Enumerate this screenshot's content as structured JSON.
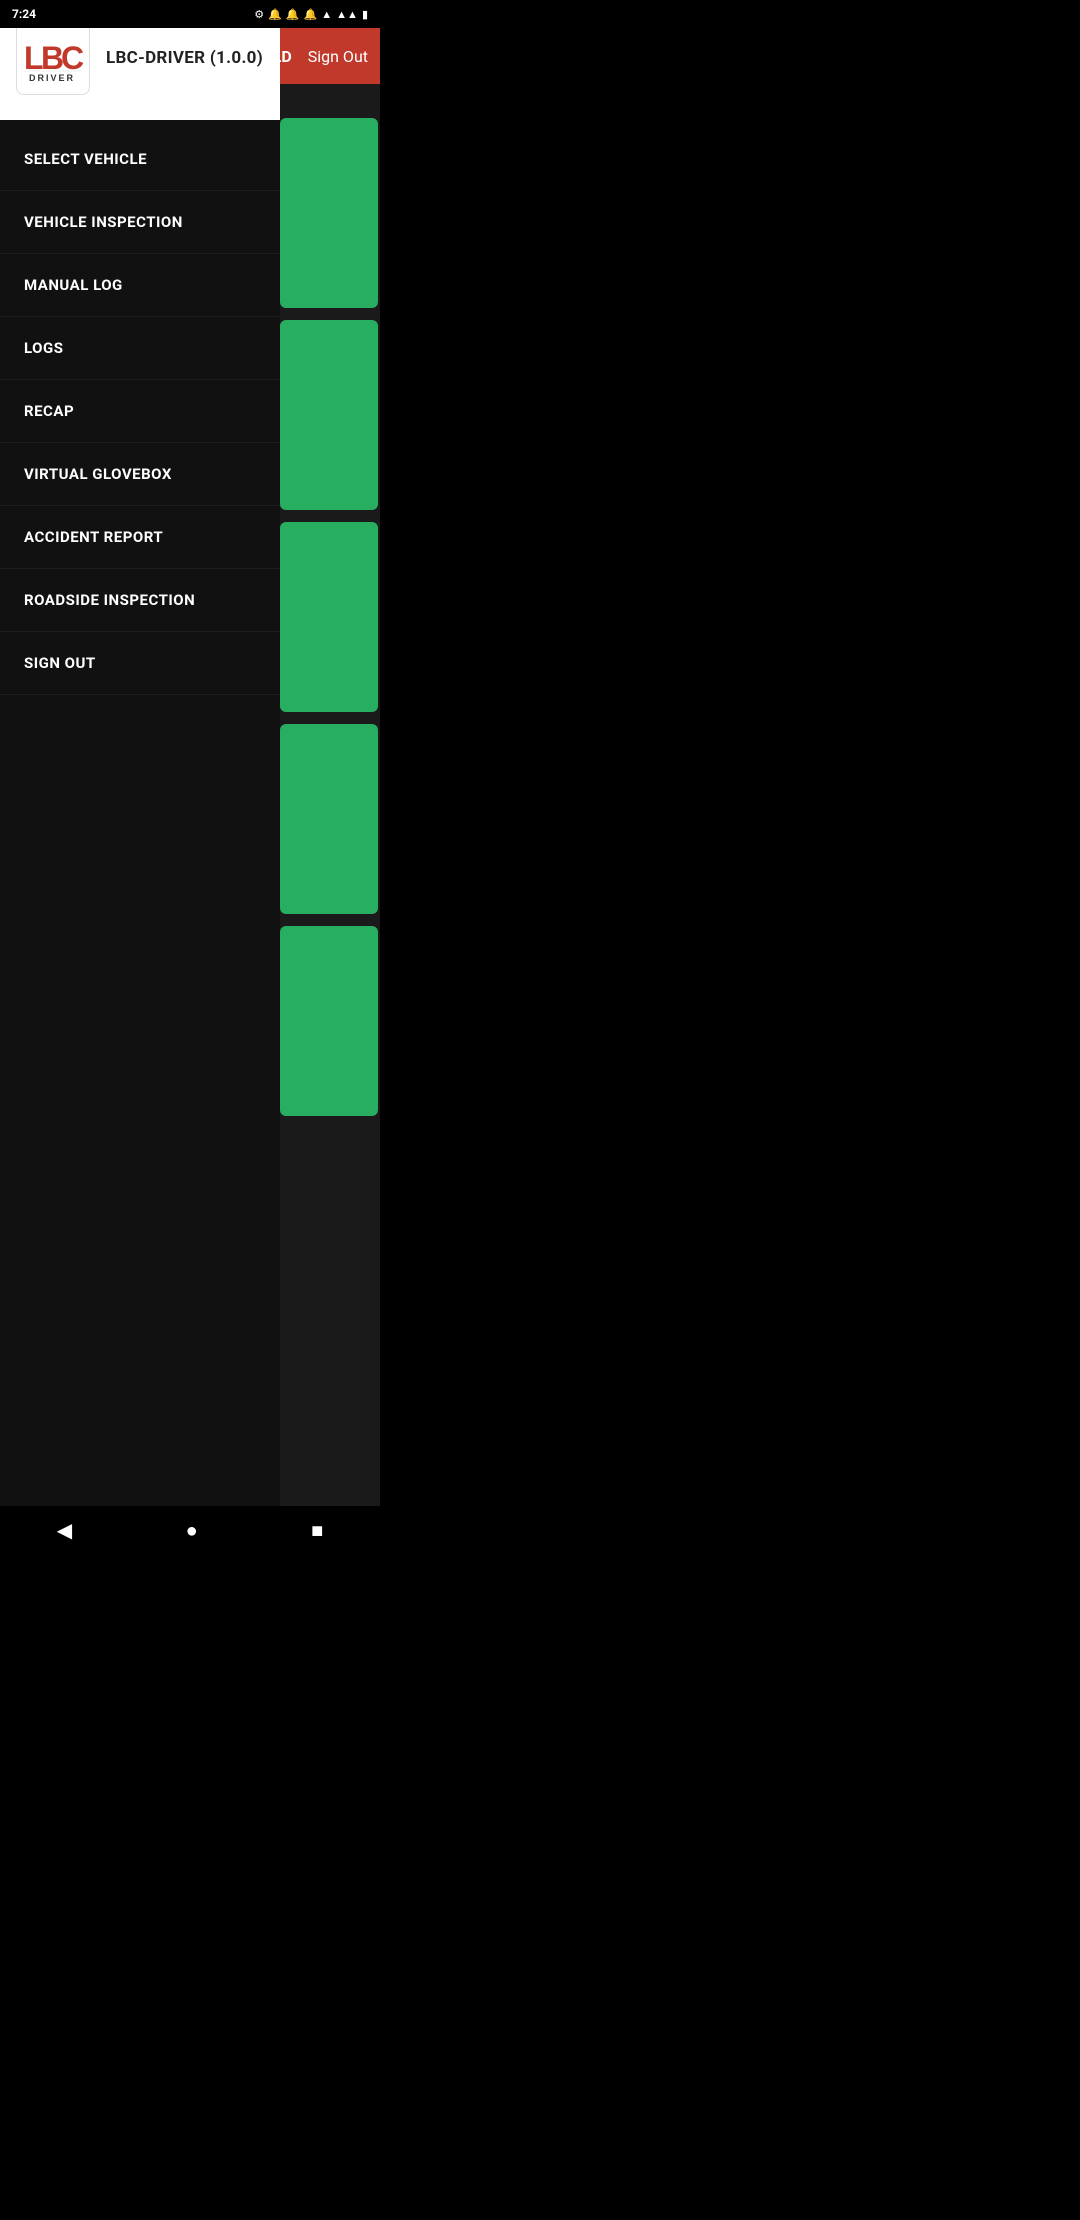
{
  "statusBar": {
    "time": "7:24",
    "icons": [
      "⚙",
      "🔔",
      "🔔",
      "🔔",
      "▲",
      "📶",
      "🔋"
    ]
  },
  "bgHeader": {
    "eldLabel": "ELD",
    "signOutLabel": "Sign Out"
  },
  "drawer": {
    "appName": "LBC-DRIVER",
    "appVersion": "(1.0.0)",
    "menuItems": [
      {
        "id": "select-vehicle",
        "label": "SELECT VEHICLE"
      },
      {
        "id": "vehicle-inspection",
        "label": "VEHICLE INSPECTION"
      },
      {
        "id": "manual-log",
        "label": "MANUAL LOG"
      },
      {
        "id": "logs",
        "label": "LOGS"
      },
      {
        "id": "recap",
        "label": "RECAP"
      },
      {
        "id": "virtual-glovebox",
        "label": "VIRTUAL GLOVEBOX"
      },
      {
        "id": "accident-report",
        "label": "ACCIDENT REPORT"
      },
      {
        "id": "roadside-inspection",
        "label": "ROADSIDE INSPECTION"
      },
      {
        "id": "sign-out",
        "label": "SIGN OUT"
      }
    ]
  },
  "bottomNav": {
    "backLabel": "◀",
    "homeLabel": "●",
    "recentLabel": "■"
  }
}
